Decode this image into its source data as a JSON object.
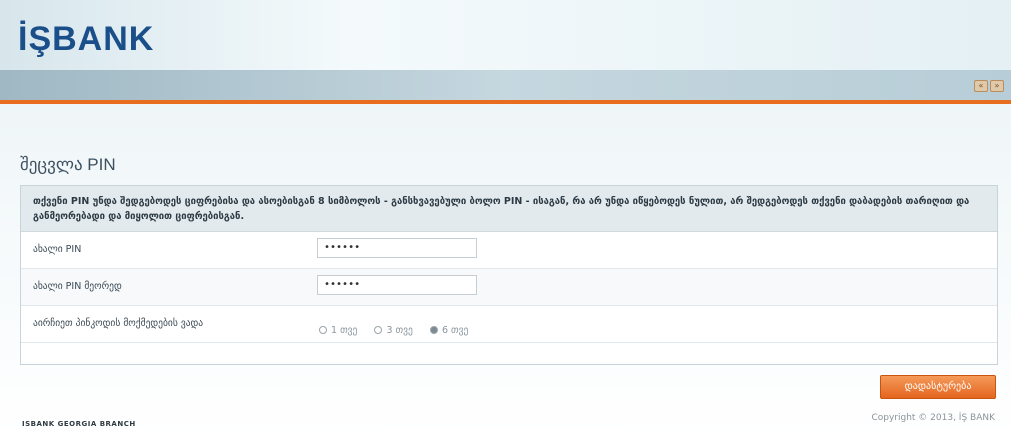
{
  "header": {
    "logo_text": "İŞBANK",
    "nav_buttons": [
      "«",
      "»"
    ]
  },
  "page": {
    "title": "შეცვლა PIN"
  },
  "panel": {
    "info_text": "თქვენი PIN უნდა შედგებოდეს ციფრებისა და ასოებისგან 8 სიმბოლოს - განსხვავებული ბოლო PIN - ისაგან, რა არ უნდა იწყებოდეს ნულით, არ შედგებოდეს თქვენი დაბადების თარიღით და განმეორებადი და მიყოლით ციფრებისგან.",
    "rows": [
      {
        "label": "ახალი PIN",
        "value": "••••••"
      },
      {
        "label": "ახალი PIN მეორედ",
        "value": "••••••"
      }
    ],
    "radio_label": "აირჩიეთ პინკოდის მოქმედების ვადა",
    "radio_options": [
      {
        "label": "1 თვე",
        "checked": false
      },
      {
        "label": "3 თვე",
        "checked": false
      },
      {
        "label": "6 თვე",
        "checked": true
      }
    ]
  },
  "actions": {
    "submit_label": "დადასტურება"
  },
  "footer": {
    "copyright": "Copyright © 2013, İŞ BANK",
    "left_text": "ISBANK GEORGIA BRANCH"
  }
}
